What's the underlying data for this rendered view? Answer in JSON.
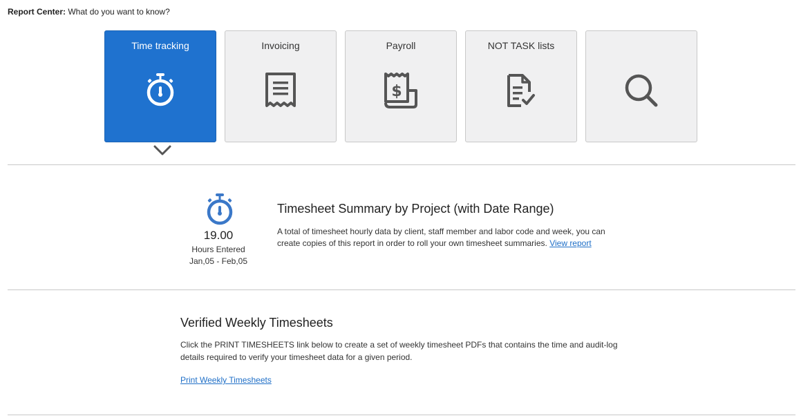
{
  "header": {
    "label": "Report Center:",
    "prompt": "What do you want to know?"
  },
  "tiles": [
    {
      "label": "Time tracking",
      "icon": "stopwatch-icon",
      "active": true
    },
    {
      "label": "Invoicing",
      "icon": "receipt-icon",
      "active": false
    },
    {
      "label": "Payroll",
      "icon": "payroll-receipt-icon",
      "active": false
    },
    {
      "label": "NOT TASK lists",
      "icon": "document-check-icon",
      "active": false
    },
    {
      "label": "",
      "icon": "search-icon",
      "active": false
    }
  ],
  "summary": {
    "icon": "stopwatch-icon",
    "value": "19.00",
    "value_label": "Hours Entered",
    "range": "Jan,05 - Feb,05"
  },
  "report": {
    "title": "Timesheet Summary by Project (with Date Range)",
    "description": "A total of timesheet hourly data by client, staff member and labor code and week, you can create copies of this report in order to roll your own timesheet summaries.",
    "link": "View report"
  },
  "verified": {
    "title": "Verified Weekly Timesheets",
    "description": "Click the PRINT TIMESHEETS link below to create a set of weekly timesheet PDFs that contains the time and audit-log details required to verify your timesheet data for a given period.",
    "link": "Print Weekly Timesheets"
  },
  "colors": {
    "accent": "#1f72cf",
    "tile_bg": "#f0f0f1",
    "link": "#1f6fc7",
    "icon_dark": "#555555"
  }
}
